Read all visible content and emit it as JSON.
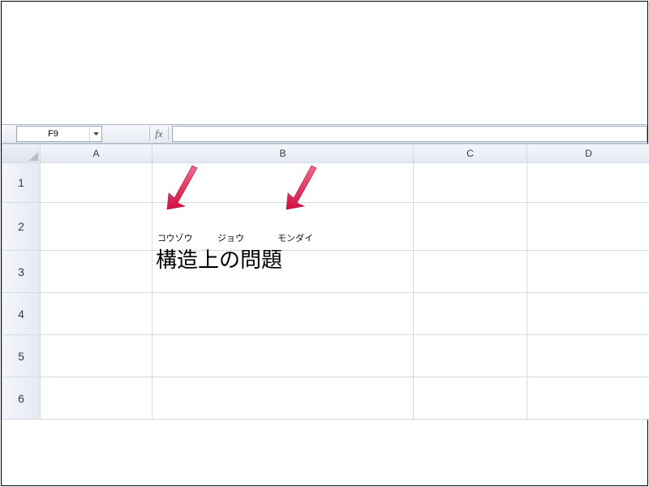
{
  "namebox": {
    "ref": "F9"
  },
  "formula_bar": {
    "fx_label": "fx",
    "value": ""
  },
  "columns": [
    "A",
    "B",
    "C",
    "D"
  ],
  "rows": [
    "1",
    "2",
    "3",
    "4",
    "5",
    "6"
  ],
  "cells": {
    "B2": {
      "ruby": {
        "kouzou": "コウゾウ",
        "jou": "ジョウ",
        "mondai": "モンダイ"
      },
      "text": "構造上の問題"
    }
  },
  "annotations": {
    "arrow1_target": "ruby-kouzou",
    "arrow2_target": "ruby-mondai",
    "arrow_color": "#e4245a"
  }
}
